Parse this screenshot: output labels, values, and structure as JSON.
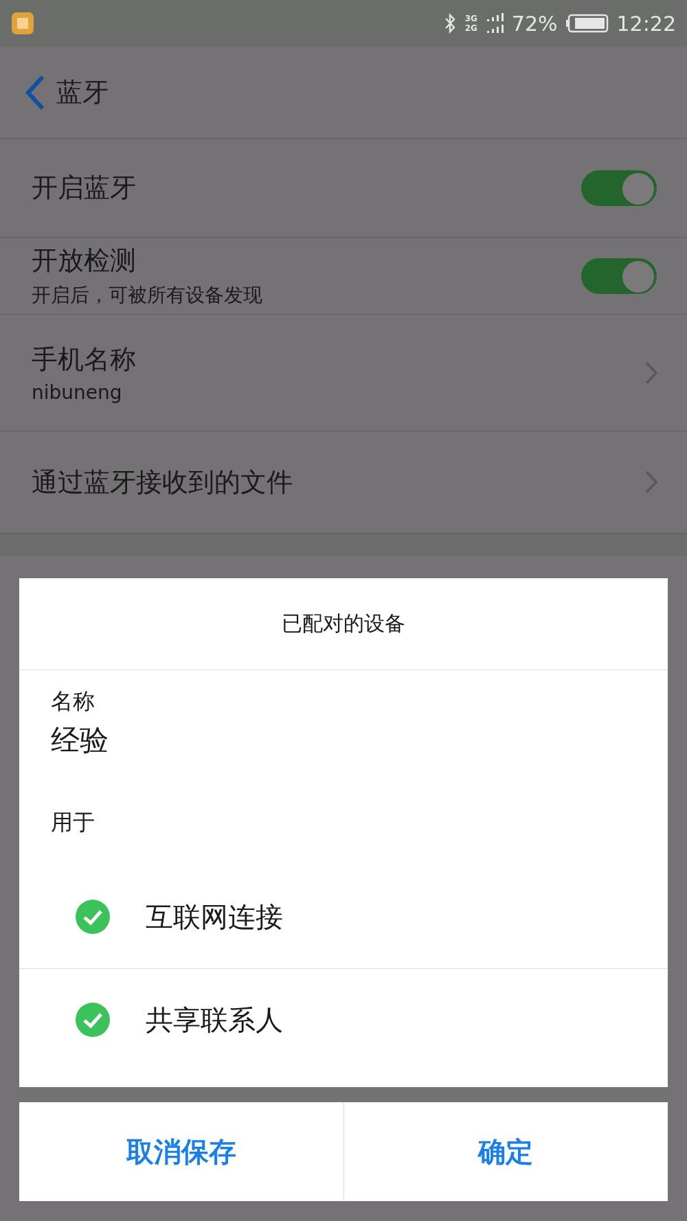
{
  "status_bar": {
    "battery": "72%",
    "time": "12:22",
    "network": [
      "3G",
      "2G"
    ]
  },
  "header": {
    "title": "蓝牙"
  },
  "settings": [
    {
      "kind": "toggle",
      "title": "开启蓝牙",
      "on": true
    },
    {
      "kind": "toggle",
      "title": "开放检测",
      "subtitle": "开启后，可被所有设备发现",
      "on": true
    },
    {
      "kind": "link",
      "title": "手机名称",
      "subtitle": "nibuneng"
    },
    {
      "kind": "link",
      "title": "通过蓝牙接收到的文件"
    }
  ],
  "dialog": {
    "title": "已配对的设备",
    "name_label": "名称",
    "name_value": "经验",
    "usage_label": "用于",
    "options": [
      {
        "label": "互联网连接",
        "checked": true
      },
      {
        "label": "共享联系人",
        "checked": true
      }
    ],
    "buttons": [
      "取消保存",
      "确定"
    ]
  }
}
